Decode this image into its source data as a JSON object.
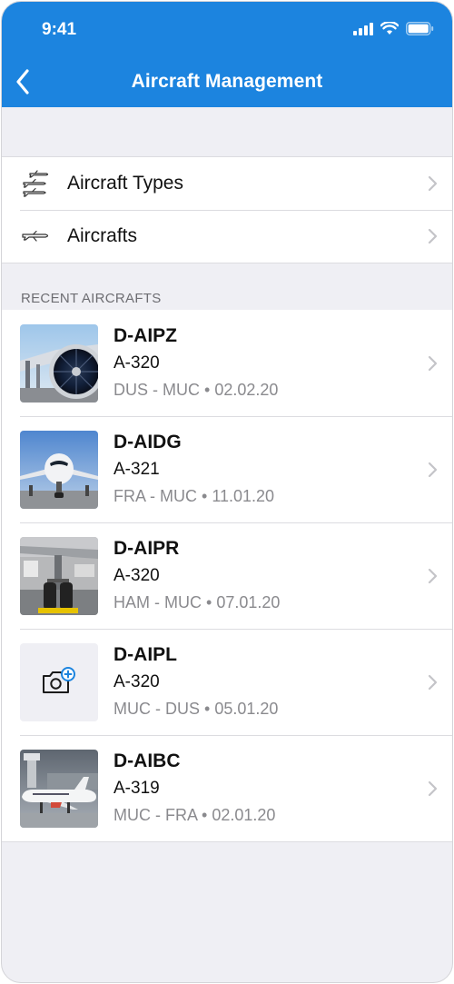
{
  "status_bar": {
    "time": "9:41",
    "icons": [
      "signal-icon",
      "wifi-icon",
      "battery-icon"
    ]
  },
  "nav": {
    "back_icon": "chevron-left-icon",
    "title": "Aircraft Management"
  },
  "menu": [
    {
      "label": "Aircraft Types",
      "icon": "multiple-planes-icon"
    },
    {
      "label": "Aircrafts",
      "icon": "plane-icon"
    }
  ],
  "section_header": "RECENT AIRCRAFTS",
  "recent": [
    {
      "registration": "D-AIPZ",
      "type": "A-320",
      "route": "DUS - MUC",
      "date": "02.02.20",
      "photo": "engine-photo"
    },
    {
      "registration": "D-AIDG",
      "type": "A-321",
      "route": "FRA - MUC",
      "date": "11.01.20",
      "photo": "nose-photo"
    },
    {
      "registration": "D-AIPR",
      "type": "A-320",
      "route": "HAM - MUC",
      "date": "07.01.20",
      "photo": "gear-photo"
    },
    {
      "registration": "D-AIPL",
      "type": "A-320",
      "route": "MUC - DUS",
      "date": "05.01.20",
      "photo": "add-photo-placeholder"
    },
    {
      "registration": "D-AIBC",
      "type": "A-319",
      "route": "MUC - FRA",
      "date": "02.01.20",
      "photo": "airport-photo"
    }
  ],
  "colors": {
    "header": "#1c84df",
    "background": "#efeff4",
    "accent": "#1c84df",
    "secondary_text": "#8a8a8e"
  }
}
